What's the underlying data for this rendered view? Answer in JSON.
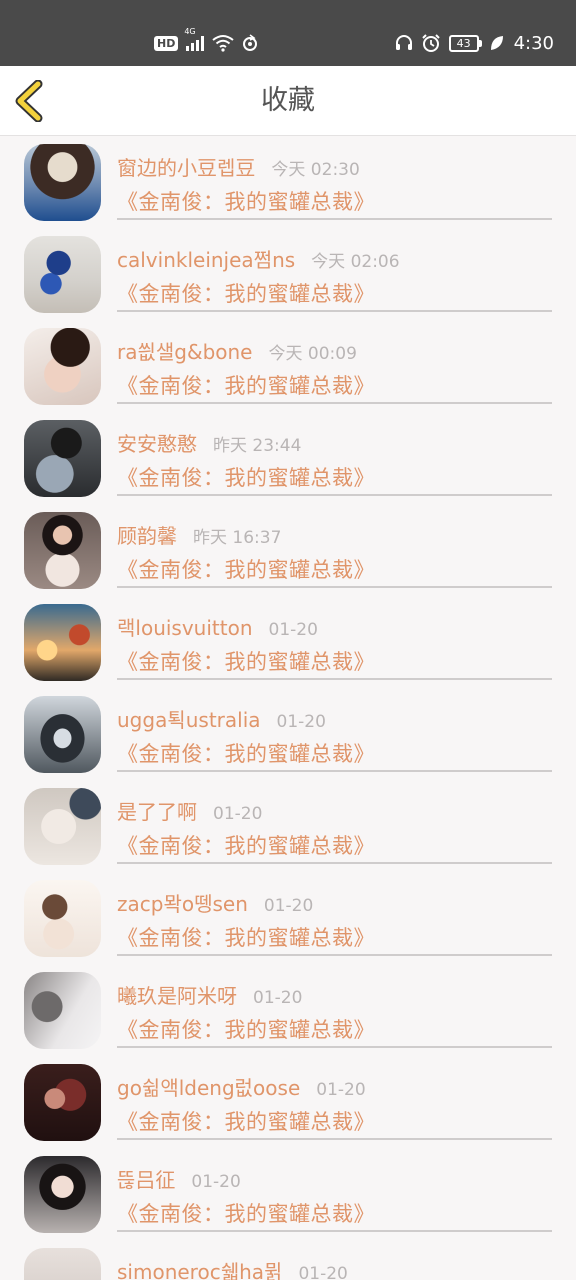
{
  "status_bar": {
    "hd_label": "HD",
    "network_label": "4G",
    "battery": "43",
    "time": "4:30",
    "icons": [
      "hd-icon",
      "signal-icon",
      "wifi-icon",
      "sync-icon",
      "headphones-icon",
      "alarm-icon",
      "battery-icon",
      "leaf-icon"
    ]
  },
  "header": {
    "title": "收藏",
    "back_icon": "chevron-left-icon",
    "accent": "#f3d23c"
  },
  "colors": {
    "name": "#e0956a",
    "timestamp": "#b9b5b5",
    "divider": "#cfcccc",
    "background": "#f8f6f6"
  },
  "favorites": [
    {
      "name": "窗边的小豆렙豆",
      "time": "今天 02:30",
      "title": "《金南俊：我的蜜罐总裁》"
    },
    {
      "name": "calvinkleinjea쩜ns",
      "time": "今天 02:06",
      "title": "《金南俊：我的蜜罐总裁》"
    },
    {
      "name": "ra씞샐g&bone",
      "time": "今天 00:09",
      "title": "《金南俊：我的蜜罐总裁》"
    },
    {
      "name": "安安憨憨",
      "time": "昨天 23:44",
      "title": "《金南俊：我的蜜罐总裁》"
    },
    {
      "name": "顾韵馨",
      "time": "昨天 16:37",
      "title": "《金南俊：我的蜜罐总裁》"
    },
    {
      "name": "랙louisvuitton",
      "time": "01-20",
      "title": "《金南俊：我的蜜罐总裁》"
    },
    {
      "name": "ugga퇵ustralia",
      "time": "01-20",
      "title": "《金南俊：我的蜜罐总裁》"
    },
    {
      "name": "是了了啊",
      "time": "01-20",
      "title": "《金南俊：我的蜜罐总裁》"
    },
    {
      "name": "zacp뫅o뗑sen",
      "time": "01-20",
      "title": "《金南俊：我的蜜罐总裁》"
    },
    {
      "name": "曦玖是阿米呀",
      "time": "01-20",
      "title": "《金南俊：我的蜜罐总裁》"
    },
    {
      "name": "go쉶액ldeng럾oose",
      "time": "01-20",
      "title": "《金南俊：我的蜜罐总裁》"
    },
    {
      "name": "뜮吕征",
      "time": "01-20",
      "title": "《金南俊：我的蜜罐总裁》"
    },
    {
      "name": "simoneroc쉛ha뮑",
      "time": "01-20",
      "title": ""
    }
  ]
}
